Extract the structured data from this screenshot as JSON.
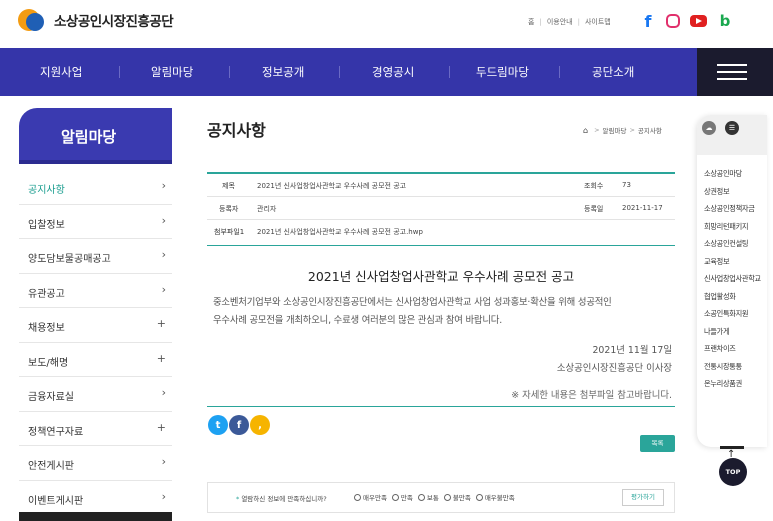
{
  "header": {
    "logo_text": "소상공인시장진흥공단",
    "utils": [
      "홈",
      "이용안내",
      "사이트맵"
    ],
    "social": [
      "facebook-icon",
      "instagram-icon",
      "youtube-icon",
      "blog-icon"
    ],
    "blog_letter": "b"
  },
  "nav": {
    "items": [
      "지원사업",
      "알림마당",
      "정보공개",
      "경영공시",
      "두드림마당",
      "공단소개"
    ]
  },
  "sidebar": {
    "title": "알림마당",
    "items": [
      {
        "label": "공지사항",
        "mark": "›"
      },
      {
        "label": "입찰정보",
        "mark": "›"
      },
      {
        "label": "양도담보물공매공고",
        "mark": "›"
      },
      {
        "label": "유관공고",
        "mark": "›"
      },
      {
        "label": "채용정보",
        "mark": "+"
      },
      {
        "label": "보도/해명",
        "mark": "+"
      },
      {
        "label": "금융자료실",
        "mark": "›"
      },
      {
        "label": "정책연구자료",
        "mark": "+"
      },
      {
        "label": "안전게시판",
        "mark": "›"
      },
      {
        "label": "이벤트게시판",
        "mark": "›"
      }
    ]
  },
  "page": {
    "title": "공지사항",
    "breadcrumb": [
      "알림마당",
      "공지사항"
    ]
  },
  "info": {
    "title_key": "제목",
    "title_val": "2021년 신사업창업사관학교 우수사례 공모전 공고",
    "views_key": "조회수",
    "views_val": "73",
    "author_key": "등록자",
    "author_val": "관리자",
    "date_key": "등록일",
    "date_val": "2021-11-17",
    "file_key": "첨부파일1",
    "file_val": "2021년 신사업창업사관학교 우수사례 공모전 공고.hwp"
  },
  "post": {
    "title": "2021년 신사업창업사관학교 우수사례 공모전 공고",
    "line1": "중소벤처기업부와 소상공인시장진흥공단에서는 신사업창업사관학교 사업 성과홍보·확산을 위해 성공적인",
    "line2": "우수사례 공모전을 개최하오니, 수료생 여러분의 많은 관심과 참여 바랍니다.",
    "date": "2021년 11월 17일",
    "org": "소상공인시장진흥공단 이사장",
    "note": "※ 자세한 내용은 첨부파일 참고바랍니다."
  },
  "buttons": {
    "list": "목록",
    "rate": "평가하기",
    "top": "TOP"
  },
  "survey": {
    "star": "*",
    "question": "열람하신 정보에 만족하십니까?",
    "options": [
      "매우만족",
      "만족",
      "보통",
      "불만족",
      "매우불만족"
    ]
  },
  "quick": {
    "items": [
      "소상공인마당",
      "상권정보",
      "소상공인정책자금",
      "희망리턴패키지",
      "소상공인컨설팅",
      "교육정보",
      "신사업창업사관학교",
      "협업활성화",
      "소공인특화지원",
      "나들가게",
      "프랜차이즈",
      "전통시장통통",
      "온누리상품권"
    ]
  }
}
